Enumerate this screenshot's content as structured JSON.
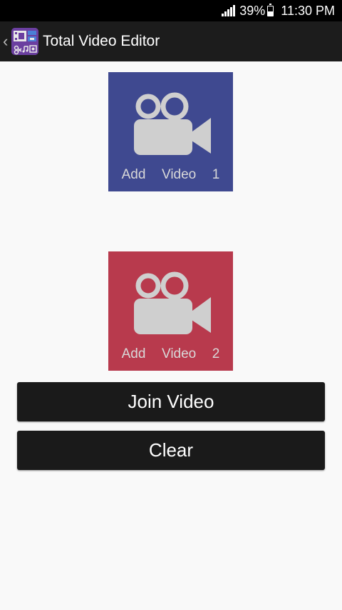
{
  "status_bar": {
    "battery": "39%",
    "time": "11:30 PM",
    "signal_icon": "signal-icon",
    "battery_icon": "battery-icon"
  },
  "action_bar": {
    "title": "Total Video Editor",
    "up_icon": "chevron-left-icon",
    "logo_icon": "app-logo-icon"
  },
  "tiles": [
    {
      "label": "Add  Video  1",
      "color": "#3f4990",
      "icon": "video-camera-icon"
    },
    {
      "label": "Add  Video  2",
      "color": "#b83a4d",
      "icon": "video-camera-icon"
    }
  ],
  "buttons": {
    "join": "Join Video",
    "clear": "Clear"
  }
}
